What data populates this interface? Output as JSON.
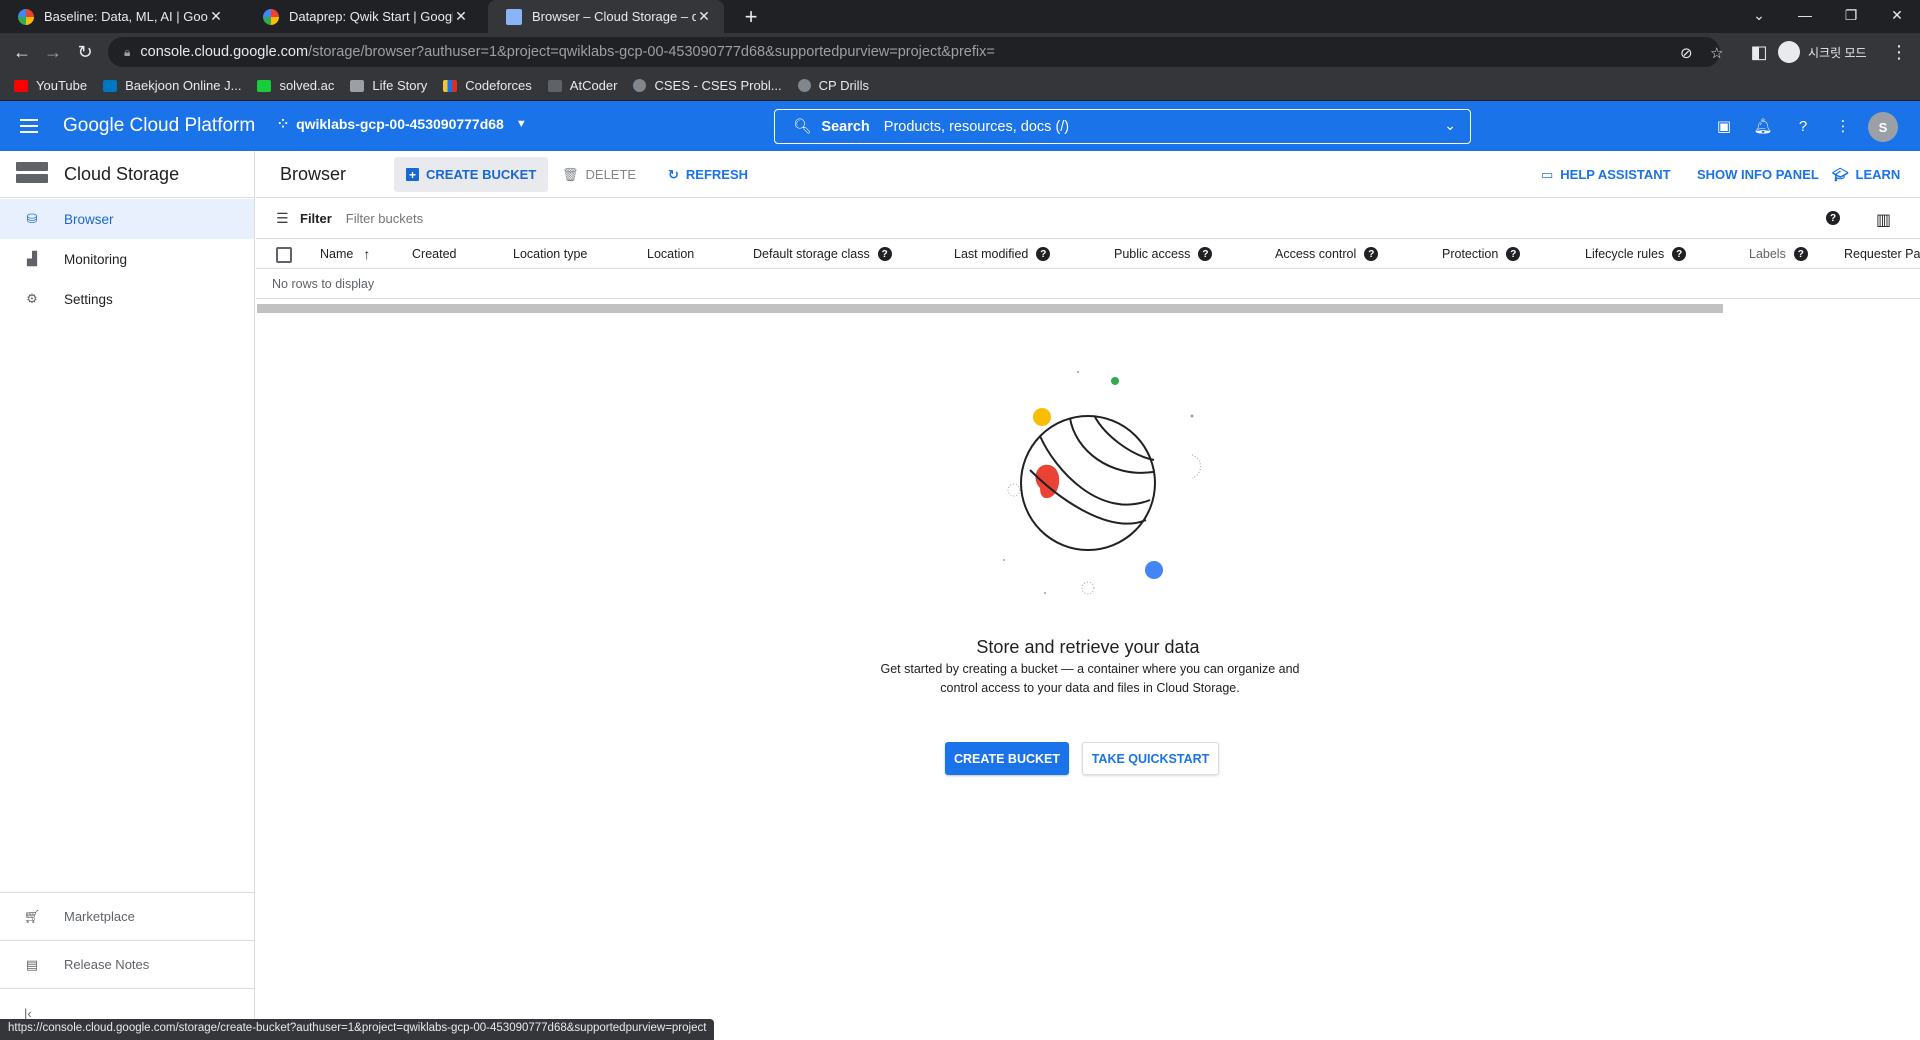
{
  "browser": {
    "tabs": [
      {
        "title": "Baseline: Data, ML, AI | Google",
        "icon": "gcp-favicon"
      },
      {
        "title": "Dataprep: Qwik Start | Google C",
        "icon": "gcp-favicon"
      },
      {
        "title": "Browser – Cloud Storage – qwik",
        "icon": "storage-favicon",
        "active": true
      }
    ],
    "url_host": "console.cloud.google.com",
    "url_rest": "/storage/browser?authuser=1&project=qwiklabs-gcp-00-453090777d68&supportedpurview=project&prefix=",
    "profile_label": "시크릿 모드",
    "bookmarks": [
      {
        "label": "YouTube",
        "color": "#ff0000"
      },
      {
        "label": "Baekjoon Online J...",
        "color": "#0076c0"
      },
      {
        "label": "solved.ac",
        "color": "#17ce3a"
      },
      {
        "label": "Life Story",
        "color": "#9aa0a6"
      },
      {
        "label": "Codeforces",
        "color": "#f4c430"
      },
      {
        "label": "AtCoder",
        "color": "#5f6368"
      },
      {
        "label": "CSES - CSES Probl...",
        "color": "#80868b"
      },
      {
        "label": "CP Drills",
        "color": "#80868b"
      }
    ],
    "status_url": "https://console.cloud.google.com/storage/create-bucket?authuser=1&project=qwiklabs-gcp-00-453090777d68&supportedpurview=project"
  },
  "header": {
    "title": "Google Cloud Platform",
    "project": "qwiklabs-gcp-00-453090777d68",
    "search_label": "Search",
    "search_placeholder": "Products, resources, docs (/)",
    "avatar_letter": "S",
    "brand_color": "#1a73e8"
  },
  "sidenav": {
    "title": "Cloud Storage",
    "items": [
      {
        "label": "Browser",
        "icon": "bucket-icon",
        "active": true
      },
      {
        "label": "Monitoring",
        "icon": "chart-icon"
      },
      {
        "label": "Settings",
        "icon": "gear-icon"
      }
    ],
    "bottom": [
      {
        "label": "Marketplace",
        "icon": "cart-icon"
      },
      {
        "label": "Release Notes",
        "icon": "notes-icon"
      }
    ]
  },
  "toolbar": {
    "title": "Browser",
    "create_bucket": "CREATE BUCKET",
    "delete": "DELETE",
    "refresh": "REFRESH",
    "help_assistant": "HELP ASSISTANT",
    "show_info_panel": "SHOW INFO PANEL",
    "learn": "LEARN"
  },
  "filter": {
    "label": "Filter",
    "placeholder": "Filter buckets"
  },
  "table": {
    "columns": [
      {
        "label": "Name",
        "sort": "asc"
      },
      {
        "label": "Created"
      },
      {
        "label": "Location type"
      },
      {
        "label": "Location"
      },
      {
        "label": "Default storage class",
        "help": true
      },
      {
        "label": "Last modified",
        "help": true
      },
      {
        "label": "Public access",
        "help": true
      },
      {
        "label": "Access control",
        "help": true
      },
      {
        "label": "Protection",
        "help": true
      },
      {
        "label": "Lifecycle rules",
        "help": true
      },
      {
        "label": "Labels",
        "help": true,
        "muted": true
      },
      {
        "label": "Requester Pays"
      }
    ],
    "empty_text": "No rows to display"
  },
  "empty_state": {
    "title": "Store and retrieve your data",
    "description": "Get started by creating a bucket — a container where you can organize and control access to your data and files in Cloud Storage.",
    "primary_button": "CREATE BUCKET",
    "secondary_button": "TAKE QUICKSTART"
  }
}
